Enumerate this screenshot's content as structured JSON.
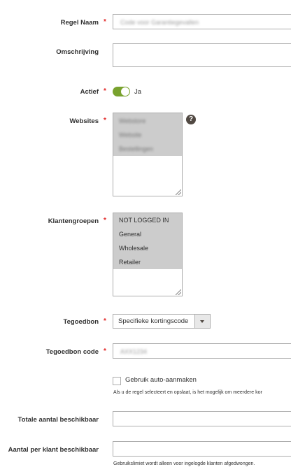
{
  "rule_name": {
    "label": "Regel Naam",
    "value": "Code voor Garantiegevallen"
  },
  "description": {
    "label": "Omschrijving",
    "value": ""
  },
  "active": {
    "label": "Actief",
    "value_label": "Ja",
    "on": true,
    "color": "#79a22e"
  },
  "websites": {
    "label": "Websites",
    "help_icon": "?",
    "options": [
      "Webstore",
      "Website",
      "Bestellingen"
    ]
  },
  "customer_groups": {
    "label": "Klantengroepen",
    "options": [
      "NOT LOGGED IN",
      "General",
      "Wholesale",
      "Retailer"
    ]
  },
  "coupon": {
    "label": "Tegoedbon",
    "selected": "Specifieke kortingscode"
  },
  "coupon_code": {
    "label": "Tegoedbon code",
    "value": "AXX1234"
  },
  "auto_generate": {
    "label": "Gebruik auto-aanmaken",
    "checked": false,
    "note": "Als u de regel selecteert en opslaat, is het mogelijk om meerdere kor"
  },
  "uses_per_coupon": {
    "label": "Totale aantal beschikbaar",
    "value": ""
  },
  "uses_per_customer": {
    "label": "Aantal per klant beschikbaar",
    "value": "",
    "note": "Gebruikslimiet wordt alleen voor ingelogde klanten afgedwongen."
  },
  "required_mark": "*"
}
